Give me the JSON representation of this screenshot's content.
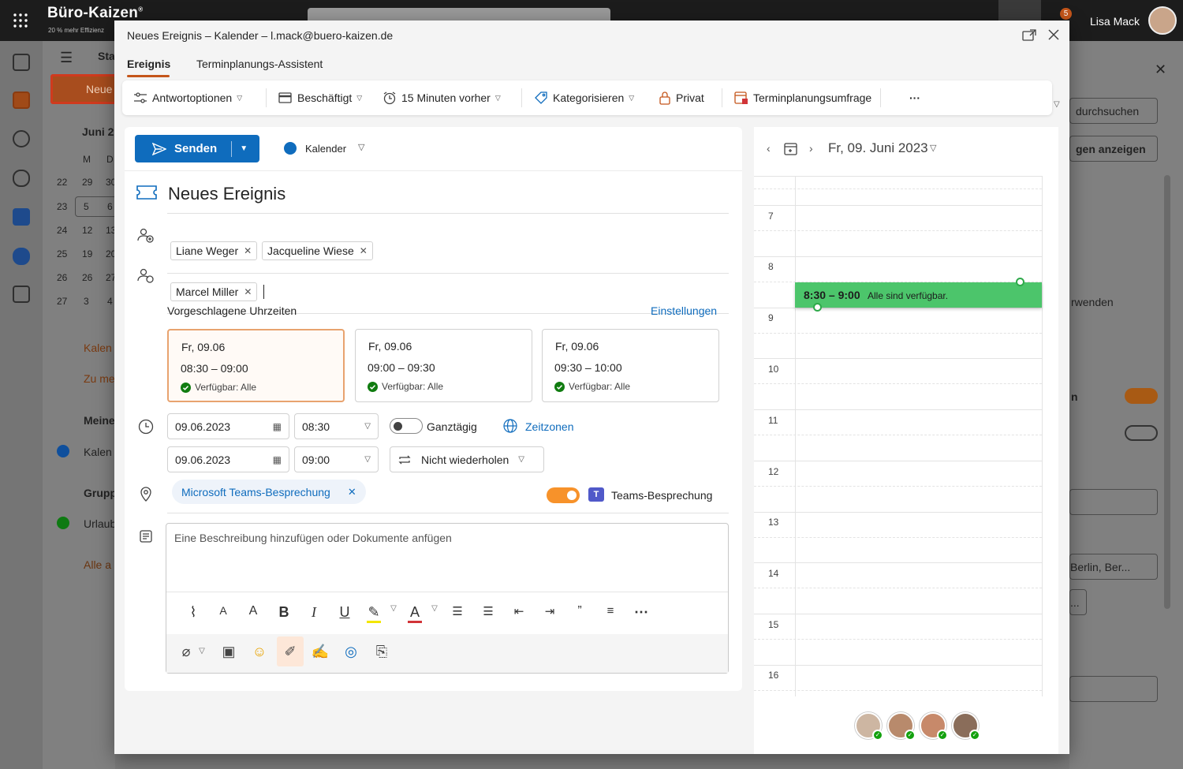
{
  "app": {
    "brand": "Büro-Kaizen",
    "brand_mark": "®",
    "brand_tagline": "20 % mehr Effizienz",
    "user_name": "Lisa Mack",
    "notification_count": "5"
  },
  "background": {
    "new_button_label": "Neue",
    "view_label": "Sta",
    "month_label": "Juni 2",
    "weekday_headers": [
      "M",
      "D"
    ],
    "weeks": [
      {
        "kw": "22",
        "d1": "29",
        "d2": "30"
      },
      {
        "kw": "23",
        "d1": "5",
        "d2": "6"
      },
      {
        "kw": "24",
        "d1": "12",
        "d2": "13"
      },
      {
        "kw": "25",
        "d1": "19",
        "d2": "20"
      },
      {
        "kw": "26",
        "d1": "26",
        "d2": "27"
      },
      {
        "kw": "27",
        "d1": "3",
        "d2": "4"
      }
    ],
    "add_calendar": "Kalen",
    "to_my": "Zu me",
    "my_calendars": "Meine",
    "calendar_item": "Kalen",
    "groups": "Grupp",
    "vacation_item": "Urlaub",
    "all": "Alle a",
    "right_search": "durchsuchen",
    "right_show": "gen anzeigen",
    "right_use": "rwenden",
    "right_n": "n",
    "right_location": "Berlin, Ber...",
    "right_more": "..."
  },
  "dialog": {
    "title": "Neues Ereignis – Kalender – l.mack@buero-kaizen.de",
    "tabs": [
      {
        "label": "Ereignis",
        "active": true
      },
      {
        "label": "Terminplanungs-Assistent",
        "active": false
      }
    ],
    "toolbar": {
      "response_options": "Antwortoptionen",
      "busy": "Beschäftigt",
      "reminder": "15 Minuten vorher",
      "categorize": "Kategorisieren",
      "private": "Privat",
      "scheduling_poll": "Terminplanungsumfrage",
      "more": "···"
    },
    "send_label": "Senden",
    "calendar_label": "Kalender",
    "event_title": "Neues Ereignis",
    "required_attendees": [
      "Liane Weger",
      "Jacqueline Wiese"
    ],
    "optional_attendees": [
      "Marcel Miller"
    ],
    "suggested_times": {
      "label": "Vorgeschlagene Uhrzeiten",
      "settings_link": "Einstellungen",
      "slots": [
        {
          "date": "Fr, 09.06",
          "time": "08:30 – 09:00",
          "availability": "Verfügbar: Alle",
          "selected": true
        },
        {
          "date": "Fr, 09.06",
          "time": "09:00 – 09:30",
          "availability": "Verfügbar: Alle",
          "selected": false
        },
        {
          "date": "Fr, 09.06",
          "time": "09:30 – 10:00",
          "availability": "Verfügbar: Alle",
          "selected": false
        }
      ]
    },
    "start_date": "09.06.2023",
    "start_time": "08:30",
    "end_date": "09.06.2023",
    "end_time": "09:00",
    "all_day_label": "Ganztägig",
    "all_day_on": false,
    "timezones_link": "Zeitzonen",
    "repeat_label": "Nicht wiederholen",
    "location_chip": "Microsoft Teams-Besprechung",
    "teams_meeting_label": "Teams-Besprechung",
    "teams_meeting_on": true,
    "description_placeholder": "Eine Beschreibung hinzufügen oder Dokumente anfügen",
    "calendar_view": {
      "date_label": "Fr, 09. Juni 2023",
      "hours": [
        "7",
        "8",
        "9",
        "10",
        "11",
        "12",
        "13",
        "14",
        "15",
        "16"
      ],
      "proposed_time": "8:30 – 9:00",
      "proposed_status": "Alle sind verfügbar."
    }
  },
  "colors": {
    "accent": "#0f6cbd",
    "brand_orange": "#c4551a",
    "available_green": "#4cc56b",
    "toggle_on": "#f7922a"
  }
}
